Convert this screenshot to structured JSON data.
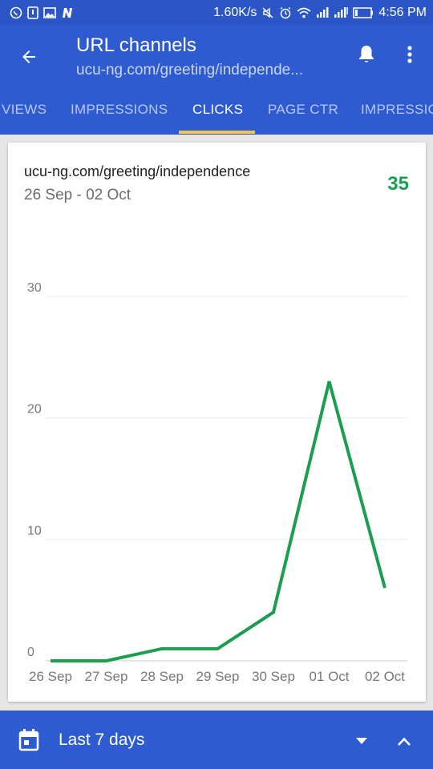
{
  "status_bar": {
    "network_speed": "1.60K/s",
    "time": "4:56 PM",
    "left_icons": [
      "whatsapp-icon",
      "notification-icon",
      "gallery-icon",
      "n-icon"
    ],
    "right_icons": [
      "mute-icon",
      "alarm-icon",
      "wifi-icon",
      "signal-icon",
      "signal-icon",
      "battery-icon"
    ]
  },
  "header": {
    "title": "URL channels",
    "subtitle": "ucu-ng.com/greeting/independe..."
  },
  "tabs": [
    {
      "label": "VIEWS",
      "active": false
    },
    {
      "label": "IMPRESSIONS",
      "active": false
    },
    {
      "label": "CLICKS",
      "active": true
    },
    {
      "label": "PAGE CTR",
      "active": false
    },
    {
      "label": "IMPRESSIO",
      "active": false
    }
  ],
  "card": {
    "url": "ucu-ng.com/greeting/independence",
    "date_range": "26 Sep - 02 Oct",
    "total": "35"
  },
  "chart_data": {
    "type": "line",
    "categories": [
      "26 Sep",
      "27 Sep",
      "28 Sep",
      "29 Sep",
      "30 Sep",
      "01 Oct",
      "02 Oct"
    ],
    "series": [
      {
        "values": [
          0,
          0,
          1,
          1,
          4,
          23,
          6
        ]
      }
    ],
    "yticks": [
      "0",
      "10",
      "20",
      "30"
    ],
    "ylim": [
      0,
      30
    ],
    "grid": true,
    "line_color": "#1c9e4f"
  },
  "bottom_bar": {
    "range_label": "Last 7 days"
  },
  "colors": {
    "primary": "#2f5bd0",
    "accent": "#f6c343",
    "positive": "#1c9e4f"
  }
}
